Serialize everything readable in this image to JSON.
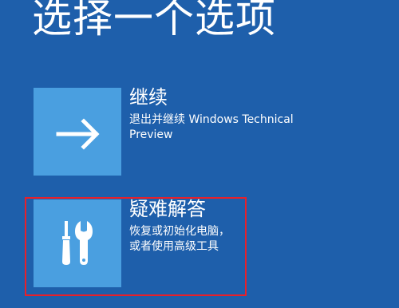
{
  "screen": {
    "title": "选择一个选项"
  },
  "options": [
    {
      "label": "继续",
      "description": "退出并继续 Windows Technical Preview",
      "icon": "arrow-right-icon"
    },
    {
      "label": "疑难解答",
      "description_line1": "恢复或初始化电脑，",
      "description_line2": "或者使用高级工具",
      "icon": "tools-icon"
    }
  ],
  "colors": {
    "background": "#1e5fab",
    "tile": "#4a9fe0",
    "highlight": "#e8202a",
    "text": "#ffffff"
  }
}
